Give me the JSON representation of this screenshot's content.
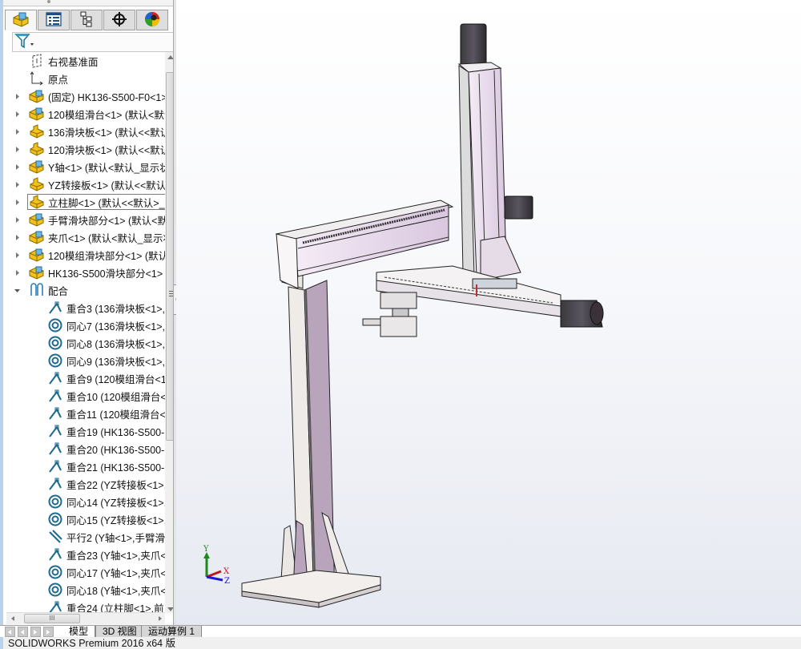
{
  "feature_manager": {
    "tabs": [
      {
        "id": "feature-manager",
        "icon": "feature-manager-tree-icon",
        "active": true
      },
      {
        "id": "property-manager",
        "icon": "property-manager-icon",
        "active": false
      },
      {
        "id": "configuration-manager",
        "icon": "configuration-manager-icon",
        "active": false
      },
      {
        "id": "dimxpert-manager",
        "icon": "dimxpert-crosshair-icon",
        "active": false
      },
      {
        "id": "display-manager",
        "icon": "display-manager-appearance-icon",
        "active": false
      }
    ],
    "filter": {
      "icon": "filter-funnel-icon",
      "dropdown": "chevron-down-icon"
    },
    "tree": [
      {
        "level": 0,
        "icon": "plane-icon",
        "label": "右视基准面",
        "expandable": false
      },
      {
        "level": 0,
        "icon": "origin-icon",
        "label": "原点",
        "expandable": false
      },
      {
        "level": 0,
        "icon": "subassembly-icon",
        "label": "(固定) HK136-S500-F0<1>",
        "expandable": true
      },
      {
        "level": 0,
        "icon": "subassembly-icon",
        "label": "120模组滑台<1> (默认<默认",
        "expandable": true
      },
      {
        "level": 0,
        "icon": "part-icon",
        "label": "136滑块板<1> (默认<<默认",
        "expandable": true
      },
      {
        "level": 0,
        "icon": "part-icon",
        "label": "120滑块板<1> (默认<<默认",
        "expandable": true
      },
      {
        "level": 0,
        "icon": "subassembly-icon",
        "label": "Y轴<1> (默认<默认_显示状",
        "expandable": true
      },
      {
        "level": 0,
        "icon": "part-icon",
        "label": "YZ转接板<1> (默认<<默认",
        "expandable": true
      },
      {
        "level": 0,
        "icon": "part-icon",
        "label": "立柱脚<1> (默认<<默认>_",
        "expandable": true,
        "selected": true
      },
      {
        "level": 0,
        "icon": "subassembly-icon",
        "label": "手臂滑块部分<1> (默认<默",
        "expandable": true
      },
      {
        "level": 0,
        "icon": "subassembly-icon",
        "label": "夹爪<1> (默认<默认_显示状",
        "expandable": true
      },
      {
        "level": 0,
        "icon": "subassembly-icon",
        "label": "120模组滑块部分<1> (默认",
        "expandable": true
      },
      {
        "level": 0,
        "icon": "subassembly-icon",
        "label": "HK136-S500滑块部分<1>",
        "expandable": true
      },
      {
        "level": 0,
        "icon": "mates-folder-icon",
        "label": "配合",
        "expandable": true,
        "expanded": true
      },
      {
        "level": 1,
        "icon": "coincident-mate-icon",
        "label": "重合3 (136滑块板<1>,"
      },
      {
        "level": 1,
        "icon": "concentric-mate-icon",
        "label": "同心7 (136滑块板<1>,"
      },
      {
        "level": 1,
        "icon": "concentric-mate-icon",
        "label": "同心8 (136滑块板<1>,"
      },
      {
        "level": 1,
        "icon": "concentric-mate-icon",
        "label": "同心9 (136滑块板<1>,"
      },
      {
        "level": 1,
        "icon": "coincident-mate-icon",
        "label": "重合9 (120模组滑台<1"
      },
      {
        "level": 1,
        "icon": "coincident-mate-icon",
        "label": "重合10 (120模组滑台<"
      },
      {
        "level": 1,
        "icon": "coincident-mate-icon",
        "label": "重合11 (120模组滑台<"
      },
      {
        "level": 1,
        "icon": "coincident-mate-icon",
        "label": "重合19 (HK136-S500-"
      },
      {
        "level": 1,
        "icon": "coincident-mate-icon",
        "label": "重合20 (HK136-S500-"
      },
      {
        "level": 1,
        "icon": "coincident-mate-icon",
        "label": "重合21 (HK136-S500-"
      },
      {
        "level": 1,
        "icon": "coincident-mate-icon",
        "label": "重合22 (YZ转接板<1>,"
      },
      {
        "level": 1,
        "icon": "concentric-mate-icon",
        "label": "同心14 (YZ转接板<1>,"
      },
      {
        "level": 1,
        "icon": "concentric-mate-icon",
        "label": "同心15 (YZ转接板<1>,"
      },
      {
        "level": 1,
        "icon": "parallel-mate-icon",
        "label": "平行2 (Y轴<1>,手臂滑"
      },
      {
        "level": 1,
        "icon": "coincident-mate-icon",
        "label": "重合23 (Y轴<1>,夹爪<"
      },
      {
        "level": 1,
        "icon": "concentric-mate-icon",
        "label": "同心17 (Y轴<1>,夹爪<"
      },
      {
        "level": 1,
        "icon": "concentric-mate-icon",
        "label": "同心18 (Y轴<1>,夹爪<"
      },
      {
        "level": 1,
        "icon": "coincident-mate-icon",
        "label": "重合24 (立柱脚<1>,前"
      }
    ],
    "hscroll_grip": "III"
  },
  "viewport": {
    "model": "gantry-robot-assembly",
    "triad": {
      "x": "X",
      "y": "Y",
      "z": "Z",
      "colors": {
        "x": "#c01818",
        "y": "#1a8a1a",
        "z": "#1b1bd0"
      }
    }
  },
  "bottom_tabs": [
    {
      "label": "模型",
      "active": true
    },
    {
      "label": "3D 视图",
      "active": false
    },
    {
      "label": "运动算例 1",
      "active": false
    }
  ],
  "status_bar": {
    "text": "SOLIDWORKS Premium 2016 x64 版"
  },
  "colors": {
    "part_yellow": "#f2c21a",
    "assembly_blue": "#5aa8d8",
    "mate_icon": "#2a6f8f",
    "model_lilac": "#e9dbef"
  }
}
